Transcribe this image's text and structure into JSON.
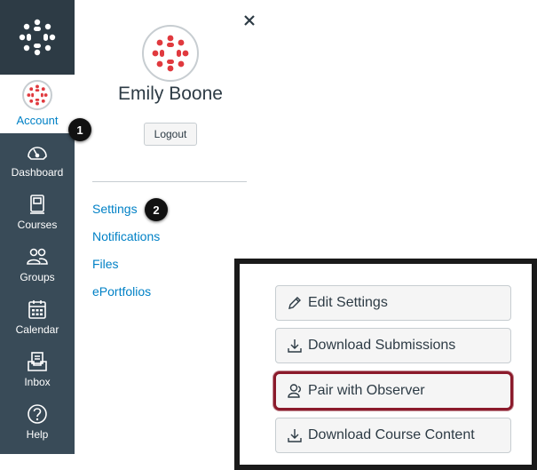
{
  "global_nav": {
    "account_label": "Account",
    "items": [
      {
        "label": "Dashboard",
        "icon": "dashboard-icon"
      },
      {
        "label": "Courses",
        "icon": "courses-icon"
      },
      {
        "label": "Groups",
        "icon": "groups-icon"
      },
      {
        "label": "Calendar",
        "icon": "calendar-icon"
      },
      {
        "label": "Inbox",
        "icon": "inbox-icon"
      },
      {
        "label": "Help",
        "icon": "help-icon"
      }
    ]
  },
  "tray": {
    "user_name": "Emily Boone",
    "logout_label": "Logout",
    "links": [
      "Settings",
      "Notifications",
      "Files",
      "ePortfolios"
    ]
  },
  "badges": [
    "1",
    "2"
  ],
  "settings_sidebar": {
    "buttons": [
      {
        "label": "Edit Settings",
        "icon": "pencil-icon"
      },
      {
        "label": "Download Submissions",
        "icon": "download-icon"
      },
      {
        "label": "Pair with Observer",
        "icon": "observer-icon"
      },
      {
        "label": "Download Course Content",
        "icon": "download-icon"
      }
    ]
  },
  "colors": {
    "nav_bg": "#394b58",
    "link": "#0081c6",
    "brand_red": "#e0393e",
    "highlight_border": "#8b1a2b"
  }
}
